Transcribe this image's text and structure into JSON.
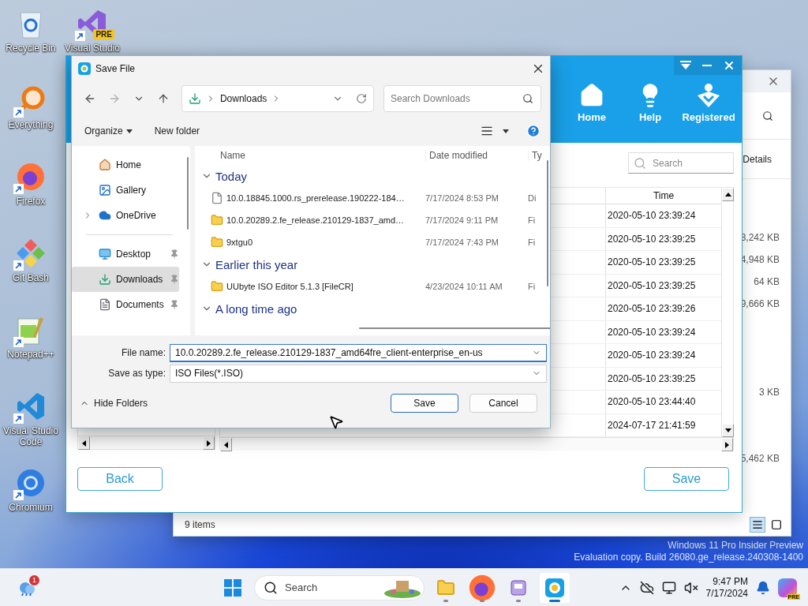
{
  "desktop": {
    "icons": [
      {
        "label": "Recycle Bin",
        "kind": "recycle-bin",
        "shortcut": false
      },
      {
        "label": "Everything",
        "kind": "magnifier",
        "shortcut": true
      },
      {
        "label": "Firefox",
        "kind": "firefox",
        "shortcut": true
      },
      {
        "label": "Git Bash",
        "kind": "gitbash",
        "shortcut": true
      },
      {
        "label": "Notepad++",
        "kind": "notepad",
        "shortcut": true
      },
      {
        "label": "Visual Studio Code",
        "kind": "vscode",
        "shortcut": true
      },
      {
        "label": "Chromium",
        "kind": "chromium",
        "shortcut": true
      },
      {
        "label": "Visual Studio",
        "kind": "vs",
        "shortcut": true,
        "badge": "PRE"
      }
    ],
    "watermark": [
      "Windows 11 Pro Insider Preview",
      "Evaluation copy. Build 26080.ge_release.240308-1400"
    ]
  },
  "explorer_window": {
    "details_label": "Details",
    "rows": [
      {
        "kind": "size",
        "size": "3,242 KB"
      },
      {
        "kind": "size",
        "size": "4,948 KB"
      },
      {
        "kind": "size",
        "size": "64 KB"
      },
      {
        "kind": "size",
        "size": "9,666 KB"
      },
      {
        "kind": "hidden"
      },
      {
        "kind": "hidden"
      },
      {
        "kind": "hidden"
      },
      {
        "kind": "size",
        "size": "3 KB"
      },
      {
        "kind": "hidden"
      },
      {
        "kind": "hidden"
      },
      {
        "kind": "size",
        "size": "5,462 KB"
      }
    ],
    "status": "9 items",
    "views": [
      {
        "kind": "details",
        "selected": true
      },
      {
        "kind": "large-icons",
        "selected": false
      }
    ]
  },
  "app_window": {
    "nav": [
      {
        "label": "Home",
        "kind": "home"
      },
      {
        "label": "Help",
        "kind": "help"
      },
      {
        "label": "Registered",
        "kind": "registered"
      }
    ],
    "search": {
      "placeholder": "Search"
    },
    "table": {
      "columns": [
        "Time"
      ],
      "rows": [
        "2020-05-10 23:39:24",
        "2020-05-10 23:39:25",
        "2020-05-10 23:39:25",
        "2020-05-10 23:39:25",
        "2020-05-10 23:39:26",
        "2020-05-10 23:39:24",
        "2020-05-10 23:39:24",
        "2020-05-10 23:39:25",
        "2020-05-10 23:44:40",
        "2024-07-17 21:41:59"
      ]
    },
    "buttons": [
      "Back",
      "Save"
    ]
  },
  "save_dialog": {
    "title": "Save File",
    "history": {
      "back_enabled": true,
      "forward_enabled": false
    },
    "breadcrumb": [
      "Downloads"
    ],
    "search": {
      "placeholder": "Search Downloads"
    },
    "commands": [
      {
        "label": "Organize",
        "menu": true
      },
      {
        "label": "New folder",
        "menu": false
      }
    ],
    "nav_pane": [
      {
        "items": [
          {
            "label": "Home",
            "kind": "home",
            "selected": false,
            "pinned": false
          },
          {
            "label": "Gallery",
            "kind": "gallery",
            "selected": false,
            "pinned": false
          },
          {
            "label": "OneDrive",
            "kind": "onedrive",
            "selected": false,
            "pinned": false,
            "expanded": false
          }
        ]
      },
      {
        "items": [
          {
            "label": "Desktop",
            "kind": "desktop",
            "selected": false,
            "pinned": true
          },
          {
            "label": "Downloads",
            "kind": "downloads",
            "selected": true,
            "pinned": true
          },
          {
            "label": "Documents",
            "kind": "documents",
            "selected": false,
            "pinned": true
          }
        ]
      }
    ],
    "columns": [
      "Name",
      "Date modified",
      "Ty"
    ],
    "groups": [
      {
        "label": "Today",
        "expanded": true,
        "items": [
          {
            "name": "10.0.18845.1000.rs_prerelease.190222-184…",
            "date": "7/17/2024 8:53 PM",
            "type": "Di",
            "kind": "file"
          },
          {
            "name": "10.0.20289.2.fe_release.210129-1837_amd…",
            "date": "7/17/2024 9:11 PM",
            "type": "Fi",
            "kind": "folder"
          },
          {
            "name": "9xtgu0",
            "date": "7/17/2024 7:43 PM",
            "type": "Fi",
            "kind": "folder"
          }
        ]
      },
      {
        "label": "Earlier this year",
        "expanded": true,
        "items": [
          {
            "name": "UUbyte ISO Editor 5.1.3 [FileCR]",
            "date": "4/23/2024 10:11 AM",
            "type": "Fi",
            "kind": "folder"
          }
        ]
      },
      {
        "label": "A long time ago",
        "expanded": true
      }
    ],
    "file_name": {
      "label": "File name:",
      "value": "10.0.20289.2.fe_release.210129-1837_amd64fre_client-enterprise_en-us"
    },
    "save_type": {
      "label": "Save as type:",
      "value": "ISO Files(*.ISO)"
    },
    "hide_folders": "Hide Folders",
    "buttons": [
      {
        "label": "Save",
        "default": true
      },
      {
        "label": "Cancel",
        "default": false
      }
    ]
  },
  "taskbar": {
    "widget_badge": "1",
    "search": {
      "placeholder": "Search"
    },
    "apps": [
      {
        "kind": "explorer",
        "active": false
      },
      {
        "kind": "firefox",
        "active": false
      },
      {
        "kind": "app",
        "active": false
      },
      {
        "kind": "uubyte",
        "active": true
      }
    ],
    "time": "9:47 PM",
    "date": "7/17/2024",
    "copilot_badge": "PRE"
  }
}
